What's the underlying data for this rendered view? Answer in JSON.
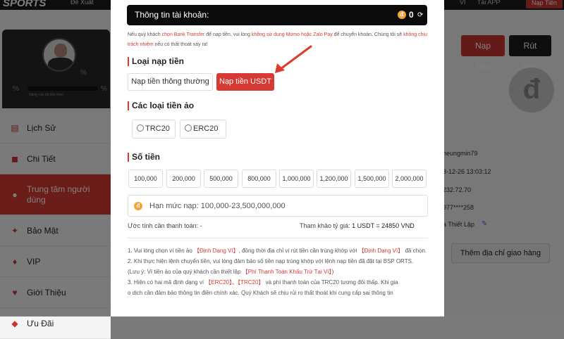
{
  "background": {
    "logo": "SPORTS",
    "topnav": "Đề Xuất",
    "top_right": [
      "",
      "VI",
      "Tải APP"
    ],
    "top_button": "Nạp Tiền",
    "level_text": "Nâng cấp đã tiếp theo",
    "pct": "%",
    "sidebar": [
      {
        "icon": "history-icon",
        "glyph": "▤",
        "label": "Lịch Sử"
      },
      {
        "icon": "details-icon",
        "glyph": "◼",
        "label": "Chi Tiết"
      },
      {
        "icon": "user-center-icon",
        "glyph": "●",
        "label": "Trung tâm người dùng"
      },
      {
        "icon": "security-icon",
        "glyph": "✦",
        "label": "Bảo Mật"
      },
      {
        "icon": "vip-icon",
        "glyph": "♦",
        "label": "VIP"
      },
      {
        "icon": "referral-icon",
        "glyph": "♥",
        "label": "Giới Thiệu"
      },
      {
        "icon": "promo-icon",
        "glyph": "◆",
        "label": "Ưu Đãi"
      }
    ],
    "deposit_button": "Nạp Tiền",
    "withdraw_button": "Rút Tiền",
    "info_lines": [
      "heungmin79",
      "3-12-26 13:03:12",
      "232.72.70",
      "977****258",
      "a Thiết Lập"
    ],
    "address_button": "Thêm địa chỉ giao hàng"
  },
  "modal": {
    "account_label": "Thông tin tài khoản:",
    "balance": "0",
    "notice": {
      "p1": "Nếu quý khách ",
      "p2": "chọn Bank Transfer",
      "p3": " để nạp tiền, vui lòng ",
      "p4": "không sử dụng Momo hoặc Zalo Pay",
      "p5": " để chuyển khoản. Chúng tôi sẽ ",
      "p6": "không chịu trách nhiệm",
      "p7": " nếu có thất thoát xảy ra!"
    },
    "deposit_type_title": "Loại nạp tiền",
    "tabs": [
      "Nạp tiền thông thường",
      "Nạp tiền USDT"
    ],
    "crypto_title": "Các loại tiền ảo",
    "crypto_options": [
      "TRC20",
      "ERC20"
    ],
    "amount_title": "Số tiền",
    "amounts": [
      "100,000",
      "200,000",
      "500,000",
      "800,000",
      "1,000,000",
      "1,200,000",
      "1,500,000",
      "2,000,000"
    ],
    "limit_placeholder": "Hạn mức nạp: 100,000-23,500,000,000",
    "estimate_label": "Ước tính cần thanh toán:",
    "estimate_value": "-",
    "rate_label": "Tham khảo tỷ giá:",
    "rate_value": "1 USDT = 24850 VND",
    "notes": {
      "n1a": "1. Vui lòng chọn ví tiền ảo ",
      "n1b": "【Định Dạng Ví】",
      "n1c": ", đồng thời địa chỉ ví rút tiền cần trùng khớp với ",
      "n1d": "【Định Dạng Ví】",
      "n1e": " đã chọn.",
      "n2": "2. Khi thực hiện lệnh chuyển tiền, vui lòng đảm bảo số tiền nạp trùng khớp với lệnh nạp tiền đã đặt tại BSP ORTS.",
      "n2b": "(Lưu ý: Ví tiền ảo của quý khách cần thiết lập ",
      "n2c": "【Phí Thanh Toán Khấu Trừ Tại Ví】",
      "n2d": ")",
      "n3a": "3. Hiện có hai mã định dạng ví ",
      "n3b": "【ERC20】",
      "n3c": "、",
      "n3d": "【TRC20】",
      "n3e": " và phí thanh toán của TRC20 tương đối thấp. Khi gia",
      "n3f": "o dịch cần đảm bảo thông tin điền chính xác. Quý Khách sẽ chịu rủi ro thất thoát khi cung cấp sai thông tin"
    }
  },
  "colors": {
    "accent": "#d63a33",
    "dark": "#0b0b0b",
    "coin": "#f1a339"
  }
}
